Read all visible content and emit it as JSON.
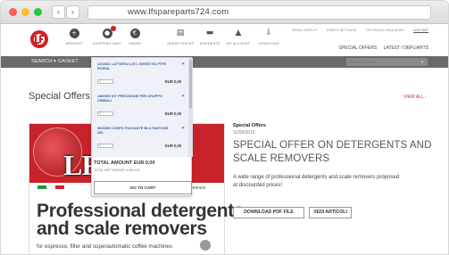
{
  "browser": {
    "url": "www.lfspareparts724.com",
    "back_icon": "chevron-left",
    "forward_icon": "chevron-right"
  },
  "header": {
    "icons": [
      {
        "name": "wishlist",
        "label": "WISHLIST",
        "glyph": "+"
      },
      {
        "name": "shopping-cart",
        "label": "SHOPPING CART",
        "glyph": "●"
      },
      {
        "name": "order",
        "label": "ORDER",
        "glyph": "€"
      },
      {
        "name": "order-status",
        "label": "ORDER STATUS",
        "glyph": "▤"
      },
      {
        "name": "shipments",
        "label": "SHIPMENTS",
        "glyph": "▬"
      },
      {
        "name": "my-account",
        "label": "MY ACCOUNT",
        "glyph": "▲"
      },
      {
        "name": "download",
        "label": "DOWNLOAD",
        "glyph": "⇩"
      }
    ],
    "top_links": [
      "MENU USER LF",
      "USER'S SETTINGS",
      "TECHNICAL ENQUIRIES",
      "LOG OUT"
    ],
    "sub_links": [
      "SPECIAL OFFERS",
      "LATEST / DEPLIANTS"
    ]
  },
  "nav": {
    "items": [
      "SEARCH",
      "GASKET"
    ],
    "search_placeholder": "Ricerca rapida"
  },
  "main": {
    "heading": "Special Offers",
    "view_all": "VIEW ALL ›"
  },
  "cart": {
    "items": [
      {
        "name": "1224921 LATTIERA 0,30 L INVESTITA PTFE ROSSA",
        "price": "EUR 0,00",
        "qty": "1"
      },
      {
        "name": "1460000 KIT PRECISIONE PER GRUPPO CIMBALI",
        "price": "EUR 0,00",
        "qty": "1"
      },
      {
        "name": "5003350 CORPO PULSANTE BLU PANTONE 293",
        "price": "EUR 0,00",
        "qty": "1"
      }
    ],
    "total": "TOTAL AMOUNT EUR 0,00",
    "weight": "TOTAL NET WEIGHT: 0,654 KG",
    "goto_label": "GO TO CART"
  },
  "banner": {
    "brand": "LF",
    "release_word": "release",
    "headline_1": "Professional detergents",
    "headline_2": "and scale removers",
    "subline": "for espresso, filter and superautomatic coffee machines",
    "flag_colors": [
      "#1a9d3a",
      "#ffffff",
      "#d11f26"
    ]
  },
  "offer": {
    "label": "Special Offers",
    "date": "11/03/2015",
    "title_1": "SPECIAL OFFER ON DETERGENTS AND",
    "title_2": "SCALE REMOVERS",
    "desc_1": "A wide range of professional detergents and scale removers proposed",
    "desc_2": "at discounted prices!",
    "btn_pdf": "DOWNLOAD PDF FILE",
    "btn_vedi": "VEDI ARTICOLI"
  },
  "colors": {
    "brand_red": "#d11f26",
    "nav_gray": "#6a6a6a",
    "cart_link_blue": "#3b5aa3"
  }
}
